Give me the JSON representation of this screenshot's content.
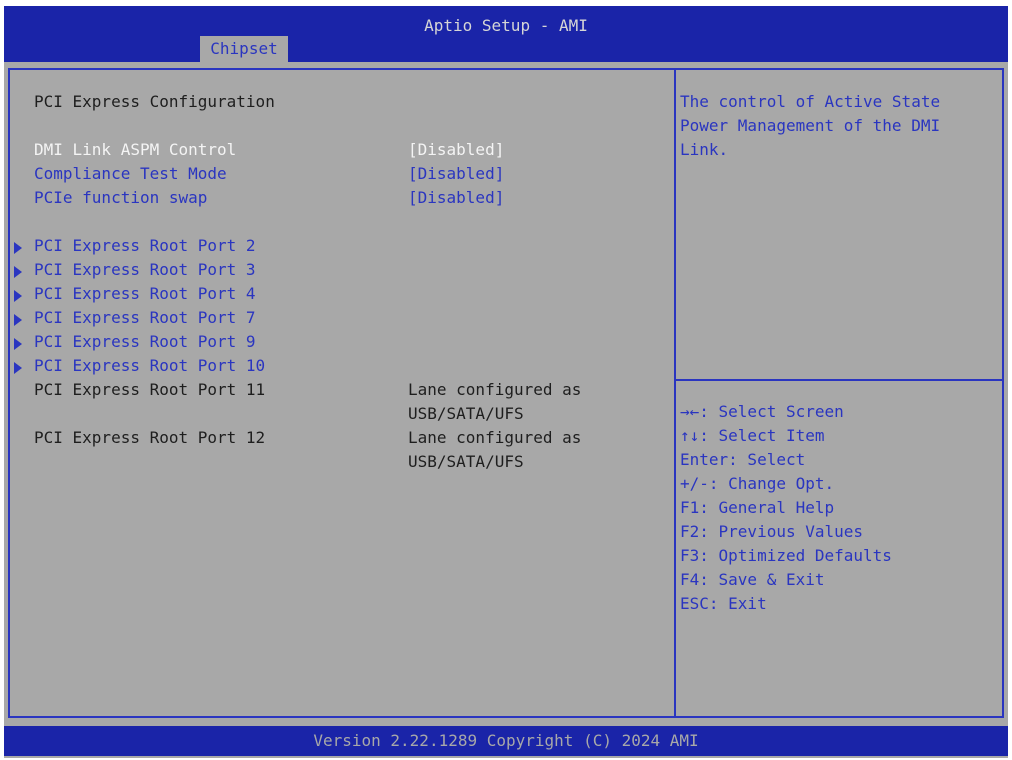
{
  "header": {
    "title": "Aptio Setup - AMI",
    "tab": "Chipset"
  },
  "main": {
    "section_title": "PCI Express Configuration",
    "settings": [
      {
        "label": "DMI Link ASPM Control",
        "value": "[Disabled]"
      },
      {
        "label": "Compliance Test Mode",
        "value": "[Disabled]"
      },
      {
        "label": "PCIe function swap",
        "value": "[Disabled]"
      }
    ],
    "submenus": [
      {
        "label": "PCI Express Root Port 2"
      },
      {
        "label": "PCI Express Root Port 3"
      },
      {
        "label": "PCI Express Root Port 4"
      },
      {
        "label": "PCI Express Root Port 7"
      },
      {
        "label": "PCI Express Root Port 9"
      },
      {
        "label": "PCI Express Root Port 10"
      }
    ],
    "static_ports": [
      {
        "label": "PCI Express Root Port 11",
        "status_line1": "Lane configured as",
        "status_line2": "USB/SATA/UFS"
      },
      {
        "label": "PCI Express Root Port 12",
        "status_line1": "Lane configured as",
        "status_line2": "USB/SATA/UFS"
      }
    ]
  },
  "help": {
    "lines": [
      "The control of Active State",
      "Power Management of the DMI",
      "Link."
    ]
  },
  "keys": [
    "→←: Select Screen",
    "↑↓: Select Item",
    "Enter: Select",
    "+/-: Change Opt.",
    "F1: General Help",
    "F2: Previous Values",
    "F3: Optimized Defaults",
    "F4: Save & Exit",
    "ESC: Exit"
  ],
  "footer": {
    "text": "Version 2.22.1289 Copyright (C) 2024 AMI"
  },
  "colors": {
    "bios_blue": "#1a24a8",
    "background": "#a8a8a8",
    "link_blue": "#2a35c0"
  }
}
